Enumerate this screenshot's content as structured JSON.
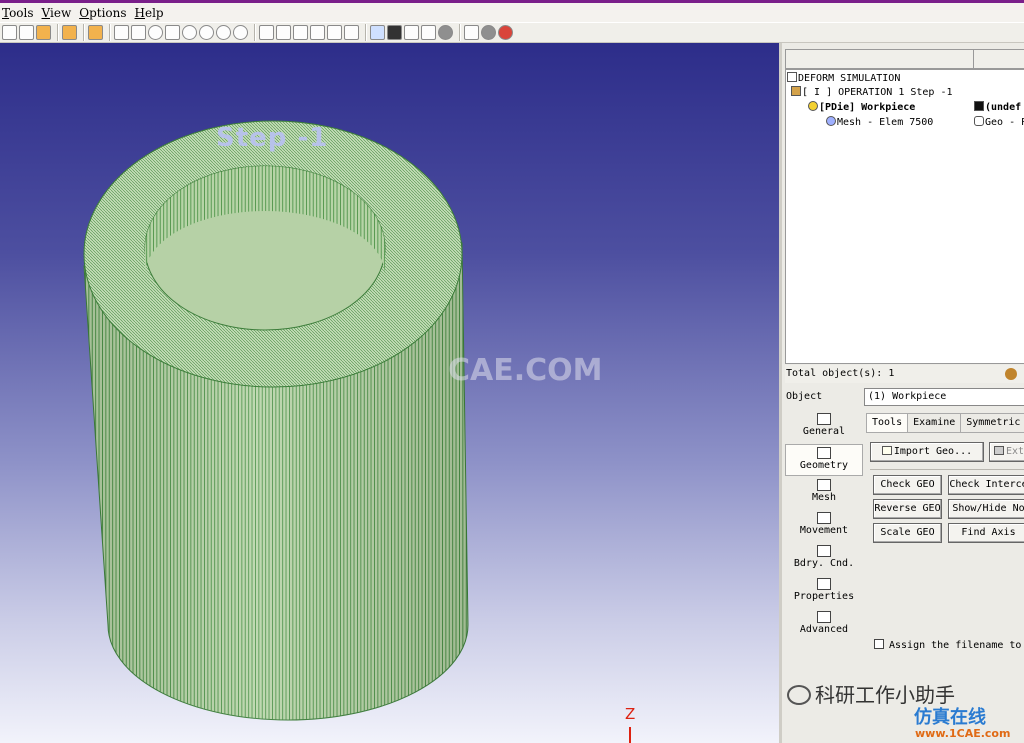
{
  "menu": [
    "Tools",
    "View",
    "Options",
    "Help"
  ],
  "toolbar": {
    "icons": [
      "new-icon",
      "open-icon",
      "save-icon",
      "folder-icon",
      "measure-icon",
      "select-arrow-icon",
      "pan-icon",
      "zoom-icon",
      "zoom-box-icon",
      "rotate-x-icon",
      "rotate-y-icon",
      "rotate-z-icon",
      "rotate-free-icon",
      "view-iso-icon",
      "view-xy-icon",
      "view-xz-icon",
      "view-yz-icon",
      "view-fit-icon",
      "view-reset-icon",
      "simulator-icon",
      "mesh-gen-icon",
      "database-icon",
      "check-icon",
      "help-icon",
      "stop-icon",
      "exit-icon"
    ]
  },
  "viewport": {
    "step_label": "Step -1",
    "watermark": "CAE.COM",
    "axis_z": "Z"
  },
  "tree": {
    "root": "DEFORM SIMULATION",
    "operation": "[ I ]  OPERATION 1  Step -1",
    "object": "[PDie] Workpiece",
    "object_status": "(undef",
    "mesh": "Mesh - Elem 7500",
    "geo": "Geo - P"
  },
  "total_objects": "Total object(s): 1",
  "object_row": {
    "label": "Object",
    "value": "(1) Workpiece"
  },
  "side_nav": [
    {
      "label": "General",
      "icon": "general-icon"
    },
    {
      "label": "Geometry",
      "icon": "geometry-icon"
    },
    {
      "label": "Mesh",
      "icon": "mesh-icon"
    },
    {
      "label": "Movement",
      "icon": "movement-icon"
    },
    {
      "label": "Bdry. Cnd.",
      "icon": "boundary-icon"
    },
    {
      "label": "Properties",
      "icon": "properties-icon"
    },
    {
      "label": "Advanced",
      "icon": "advanced-icon"
    }
  ],
  "tabs": [
    "Tools",
    "Examine",
    "Symmetric"
  ],
  "buttons": {
    "import_geo": "Import Geo...",
    "extract": "Ext",
    "check_geo": "Check GEO",
    "check_intersect": "Check Interce",
    "reverse_geo": "Reverse GEO",
    "show_hide": "Show/Hide No",
    "scale_geo": "Scale GEO",
    "find_axis": "Find Axis"
  },
  "assign_filename": "Assign the filename to t",
  "watermark_bottom": {
    "wechat": "科研工作小助手",
    "site_cn": "仿真在线",
    "site_url": "www.1CAE.com"
  }
}
